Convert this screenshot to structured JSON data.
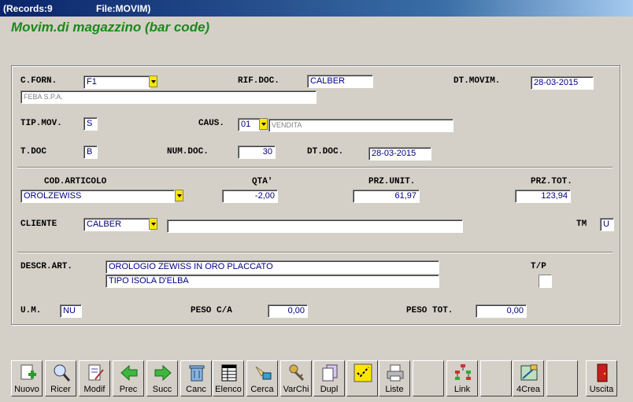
{
  "window": {
    "records": "(Records:9",
    "file": "File:MOVIM)"
  },
  "form_title": "Movim.di magazzino (bar code)",
  "labels": {
    "cforn": "C.FORN.",
    "rifdoc": "RIF.DOC.",
    "dtmovim": "DT.MOVIM.",
    "tipmov": "TIP.MOV.",
    "caus": "CAUS.",
    "tdoc": "T.DOC",
    "numdoc": "NUM.DOC.",
    "dtdoc": "DT.DOC.",
    "codart": "COD.ARTICOLO",
    "qta": "QTA'",
    "przunit": "PRZ.UNIT.",
    "prztot": "PRZ.TOT.",
    "cliente": "CLIENTE",
    "tm": "TM",
    "descrart": "DESCR.ART.",
    "tp": "T/P",
    "um": "U.M.",
    "pesoca": "PESO C/A",
    "pesotot": "PESO TOT."
  },
  "fields": {
    "cforn": "F1",
    "cforn_desc": "FEBA S.P.A.",
    "rifdoc": "CALBER",
    "dtmovim": "28-03-2015",
    "tipmov": "S",
    "caus": "01",
    "caus_desc": "VENDITA",
    "tdoc": "B",
    "numdoc": "30",
    "dtdoc": "28-03-2015",
    "codart": "OROLZEWISS",
    "qta": "-2,00",
    "przunit": "61,97",
    "prztot": "123,94",
    "cliente": "CALBER",
    "cliente_desc": "",
    "tm": "U",
    "descr1": "OROLOGIO ZEWISS IN ORO PLACCATO",
    "descr2": "TIPO ISOLA D'ELBA",
    "um": "NU",
    "pesoca": "0,00",
    "pesotot": "0,00"
  },
  "toolbar": [
    {
      "label": "Nuovo",
      "icon": "new-document-icon"
    },
    {
      "label": "Ricer",
      "icon": "magnifier-icon"
    },
    {
      "label": "Modif",
      "icon": "edit-document-icon"
    },
    {
      "label": "Prec",
      "icon": "arrow-left-icon"
    },
    {
      "label": "Succ",
      "icon": "arrow-right-icon"
    },
    {
      "label": "Canc",
      "icon": "trash-icon"
    },
    {
      "label": "Elenco",
      "icon": "table-list-icon"
    },
    {
      "label": "Cerca",
      "icon": "search-brush-icon"
    },
    {
      "label": "VarChi",
      "icon": "keys-icon"
    },
    {
      "label": "Dupl",
      "icon": "duplicate-icon"
    },
    {
      "label": "",
      "icon": "check-list-icon"
    },
    {
      "label": "Liste",
      "icon": "printer-icon"
    },
    {
      "label": "",
      "icon": ""
    },
    {
      "label": "Link",
      "icon": "link-hierarchy-icon"
    },
    {
      "label": "",
      "icon": ""
    },
    {
      "label": "4Crea",
      "icon": "create-tool-icon"
    },
    {
      "label": "",
      "icon": ""
    },
    {
      "label": "Uscita",
      "icon": "exit-door-icon"
    }
  ]
}
